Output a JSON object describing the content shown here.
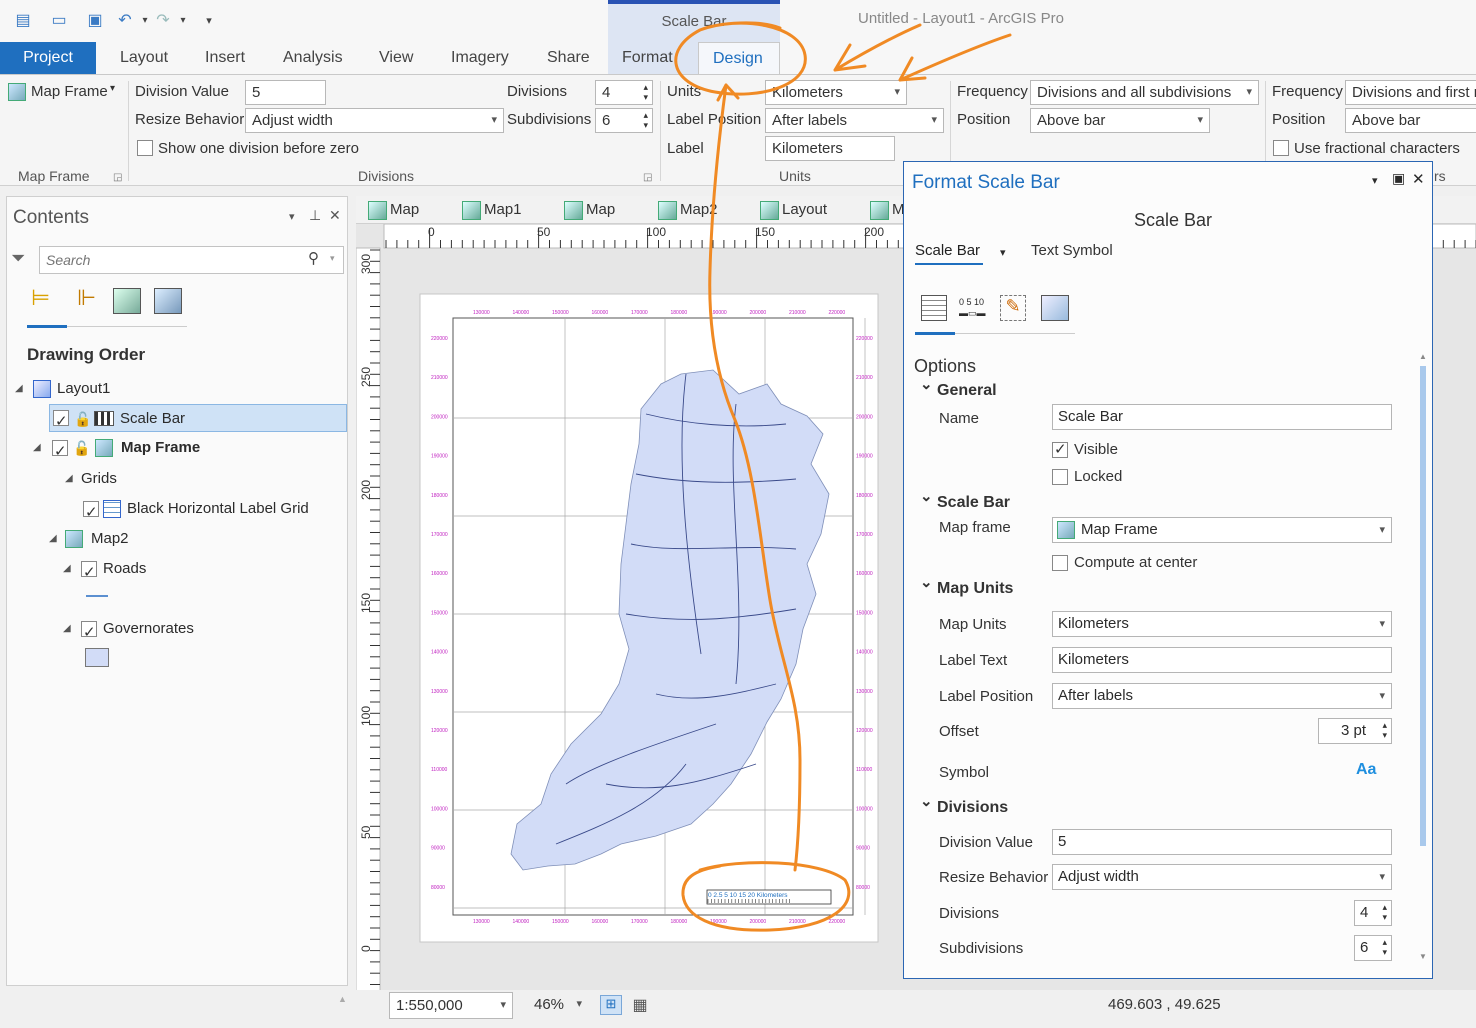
{
  "app": {
    "context_tab_group": "Scale Bar",
    "window_title": "Untitled - Layout1 - ArcGIS Pro"
  },
  "quick_access": [
    "new-project-icon",
    "open-icon",
    "save-icon",
    "undo-icon",
    "redo-icon",
    "customize-icon"
  ],
  "tabs": [
    "Project",
    "Layout",
    "Insert",
    "Analysis",
    "View",
    "Imagery",
    "Share",
    "Format",
    "Design"
  ],
  "ribbon": {
    "map_frame": {
      "button": "Map Frame",
      "group": "Map Frame"
    },
    "divisions": {
      "group": "Divisions",
      "division_value_label": "Division Value",
      "division_value": "5",
      "resize_label": "Resize Behavior",
      "resize_value": "Adjust width",
      "divisions_label": "Divisions",
      "divisions_value": "4",
      "subdivisions_label": "Subdivisions",
      "subdivisions_value": "6",
      "show_one_label": "Show one division before zero",
      "show_one_checked": false
    },
    "units": {
      "group": "Units",
      "units_label": "Units",
      "units_value": "Kilometers",
      "label_position_label": "Label Position",
      "label_position_value": "After labels",
      "label_label": "Label",
      "label_value": "Kilometers"
    },
    "marks": {
      "frequency_label": "Frequency",
      "frequency_value": "Divisions and all subdivisions",
      "position_label": "Position",
      "position_value": "Above bar"
    },
    "labels": {
      "frequency_label": "Frequency",
      "frequency_value": "Divisions and first m",
      "position_label": "Position",
      "position_value": "Above bar",
      "fractional_label": "Use fractional characters",
      "fractional_checked": false,
      "group_tail": "rs"
    }
  },
  "contents": {
    "title": "Contents",
    "search_placeholder": "Search",
    "drawing_order": "Drawing Order",
    "items": [
      {
        "label": "Layout1"
      },
      {
        "label": "Scale Bar"
      },
      {
        "label": "Map Frame"
      },
      {
        "label": "Grids"
      },
      {
        "label": "Black Horizontal Label Grid"
      },
      {
        "label": "Map2"
      },
      {
        "label": "Roads"
      },
      {
        "label": "Governorates"
      }
    ]
  },
  "view_tabs": [
    "Map",
    "Map1",
    "Map",
    "Map2",
    "Layout",
    "M"
  ],
  "ruler": {
    "top": [
      "0",
      "50",
      "100",
      "150",
      "200"
    ],
    "left": [
      "300",
      "250",
      "200",
      "150",
      "100",
      "50",
      "0"
    ]
  },
  "map_sheet": {
    "x_labels": [
      "130000",
      "140000",
      "150000",
      "160000",
      "170000",
      "180000",
      "190000",
      "200000",
      "210000",
      "220000"
    ],
    "y_labels": [
      "220000",
      "210000",
      "200000",
      "190000",
      "180000",
      "170000",
      "160000",
      "150000",
      "140000",
      "130000",
      "120000",
      "110000",
      "100000",
      "90000",
      "80000"
    ],
    "scalebar_text": "0 2.5 5     10     15     20 Kilometers"
  },
  "status": {
    "scale": "1:550,000",
    "zoom": "46%",
    "coords": "469.603 , 49.625"
  },
  "format_pane": {
    "title": "Format Scale Bar",
    "subtitle": "Scale Bar",
    "subtabs": [
      "Scale Bar",
      "Text Symbol"
    ],
    "options": "Options",
    "general": "General",
    "name_label": "Name",
    "name_value": "Scale Bar",
    "visible_label": "Visible",
    "visible_checked": true,
    "locked_label": "Locked",
    "locked_checked": false,
    "scalebar_section": "Scale Bar",
    "map_frame_label": "Map frame",
    "map_frame_value": "Map Frame",
    "compute_center_label": "Compute at center",
    "compute_center_checked": false,
    "map_units_section": "Map Units",
    "map_units_label": "Map Units",
    "map_units_value": "Kilometers",
    "label_text_label": "Label Text",
    "label_text_value": "Kilometers",
    "label_position_label": "Label Position",
    "label_position_value": "After labels",
    "offset_label": "Offset",
    "offset_value": "3 pt",
    "symbol_label": "Symbol",
    "symbol_value": "Aa",
    "divisions_section": "Divisions",
    "division_value_label": "Division Value",
    "division_value": "5",
    "resize_label": "Resize Behavior",
    "resize_value": "Adjust width",
    "divisions_label": "Divisions",
    "divisions_value": "4",
    "subdivisions_label": "Subdivisions",
    "subdivisions_value": "6"
  },
  "colors": {
    "accent": "#1f6fbf",
    "annotation": "#f08a24",
    "grid_label": "#c020c0",
    "polygon": "#d2dcf7"
  }
}
